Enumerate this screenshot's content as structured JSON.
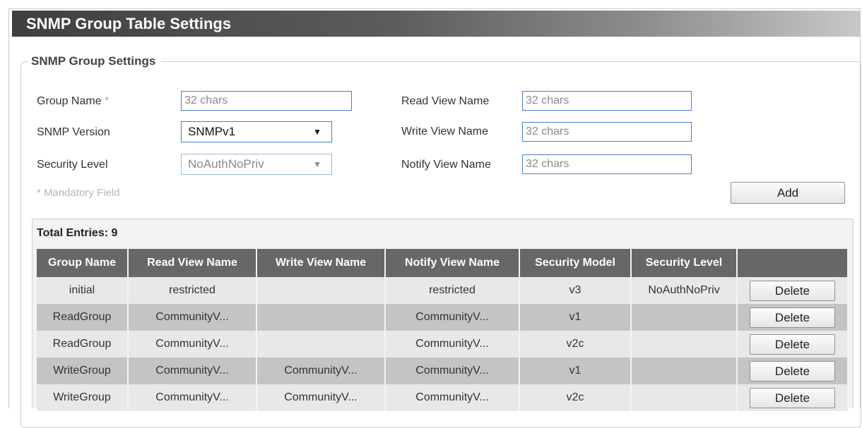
{
  "page": {
    "title": "SNMP Group Table Settings"
  },
  "settings": {
    "legend": "SNMP Group Settings",
    "group_name": {
      "label": "Group Name",
      "required_mark": "*",
      "placeholder": "32 chars",
      "value": ""
    },
    "snmp_version": {
      "label": "SNMP Version",
      "selected": "SNMPv1"
    },
    "security_level": {
      "label": "Security Level",
      "selected": "NoAuthNoPriv",
      "disabled": true
    },
    "read_view": {
      "label": "Read View Name",
      "placeholder": "32 chars",
      "value": ""
    },
    "write_view": {
      "label": "Write View Name",
      "placeholder": "32 chars",
      "value": ""
    },
    "notify_view": {
      "label": "Notify View Name",
      "placeholder": "32 chars",
      "value": ""
    },
    "mandatory_note": "* Mandatory Field",
    "add_label": "Add"
  },
  "table": {
    "total_label": "Total Entries: 9",
    "columns": [
      "Group Name",
      "Read View Name",
      "Write View Name",
      "Notify View Name",
      "Security Model",
      "Security Level",
      ""
    ],
    "rows": [
      {
        "group": "initial",
        "read": "restricted",
        "write": "",
        "notify": "restricted",
        "model": "v3",
        "level": "NoAuthNoPriv",
        "action": "Delete"
      },
      {
        "group": "ReadGroup",
        "read": "CommunityV...",
        "write": "",
        "notify": "CommunityV...",
        "model": "v1",
        "level": "",
        "action": "Delete"
      },
      {
        "group": "ReadGroup",
        "read": "CommunityV...",
        "write": "",
        "notify": "CommunityV...",
        "model": "v2c",
        "level": "",
        "action": "Delete"
      },
      {
        "group": "WriteGroup",
        "read": "CommunityV...",
        "write": "CommunityV...",
        "notify": "CommunityV...",
        "model": "v1",
        "level": "",
        "action": "Delete"
      },
      {
        "group": "WriteGroup",
        "read": "CommunityV...",
        "write": "CommunityV...",
        "notify": "CommunityV...",
        "model": "v2c",
        "level": "",
        "action": "Delete"
      }
    ]
  },
  "colors": {
    "header_bg": "#676767",
    "row_odd": "#e8e8e8",
    "row_even": "#c4c4c4",
    "input_border": "#4a7fc7"
  },
  "icons": {
    "dropdown": "chevron-down-icon"
  }
}
